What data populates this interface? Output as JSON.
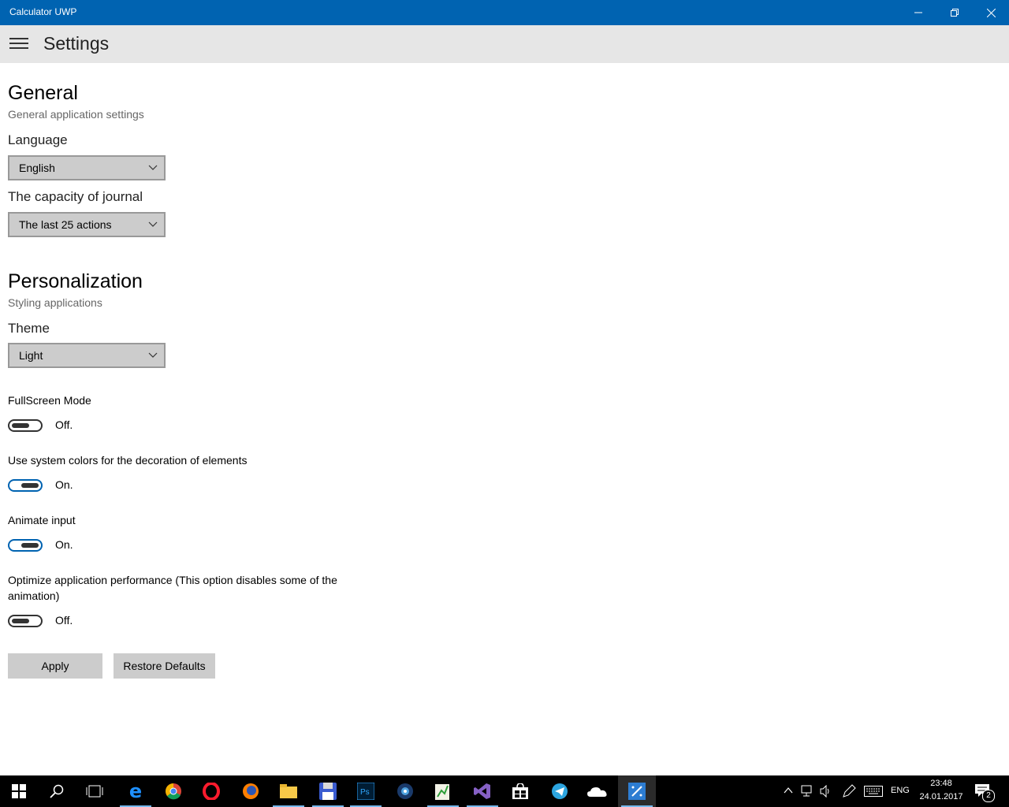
{
  "window": {
    "title": "Calculator UWP"
  },
  "header": {
    "title": "Settings"
  },
  "general": {
    "title": "General",
    "subtitle": "General application settings",
    "language_label": "Language",
    "language_value": "English",
    "journal_label": "The capacity of journal",
    "journal_value": "The last 25 actions"
  },
  "personalization": {
    "title": "Personalization",
    "subtitle": "Styling applications",
    "theme_label": "Theme",
    "theme_value": "Light"
  },
  "toggles": [
    {
      "label": "FullScreen Mode",
      "state": "Off.",
      "on": false
    },
    {
      "label": "Use system colors for the decoration of elements",
      "state": "On.",
      "on": true
    },
    {
      "label": "Animate input",
      "state": "On.",
      "on": true
    },
    {
      "label": "Optimize application performance (This option disables some of the animation)",
      "state": "Off.",
      "on": false
    }
  ],
  "buttons": {
    "apply": "Apply",
    "restore": "Restore Defaults"
  },
  "taskbar": {
    "language": "ENG",
    "time": "23:48",
    "date": "24.01.2017",
    "notification_count": "2",
    "icons": [
      "start-icon",
      "search-icon",
      "task-view-icon",
      "edge-icon",
      "chrome-icon",
      "opera-icon",
      "firefox-icon",
      "file-explorer-icon",
      "floppy-app-icon",
      "photoshop-icon",
      "media-player-icon",
      "notepad-icon",
      "visual-studio-icon",
      "store-icon",
      "telegram-icon",
      "onedrive-icon",
      "calculator-uwp-icon"
    ]
  },
  "colors": {
    "accent": "#0063b1",
    "header_bg": "#e6e6e6",
    "control_bg": "#cccccc"
  }
}
